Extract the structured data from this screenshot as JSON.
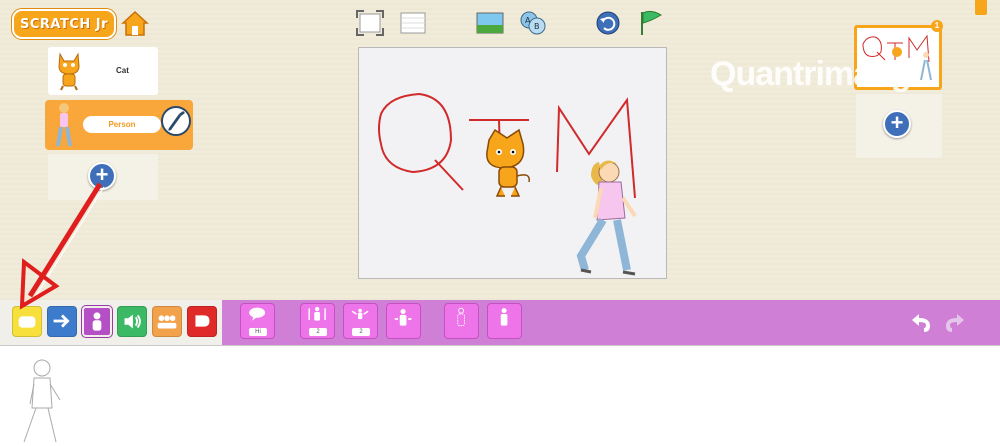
{
  "app": {
    "logo_text": "SCRATCH Jr"
  },
  "sprites": [
    {
      "label": "Cat"
    },
    {
      "label": "Person"
    }
  ],
  "stage": {
    "drawing_letters": [
      "Q",
      "T",
      "M"
    ]
  },
  "pages": {
    "current_page_badge": "1"
  },
  "watermark": "Quantrimang",
  "palette": {
    "categories": [
      {
        "name": "triggering",
        "color": "#f7e03c"
      },
      {
        "name": "motion",
        "color": "#3d7ccc"
      },
      {
        "name": "looks",
        "color": "#b44fc5"
      },
      {
        "name": "sound",
        "color": "#3cb964"
      },
      {
        "name": "control",
        "color": "#f3a24c"
      },
      {
        "name": "end",
        "color": "#e02a2a"
      }
    ],
    "blocks": [
      {
        "icon": "speech-bubble-icon",
        "value": "Hi"
      },
      {
        "icon": "grow-icon",
        "value": "2"
      },
      {
        "icon": "shrink-icon",
        "value": "2"
      },
      {
        "icon": "reset-size-icon",
        "value": ""
      },
      {
        "icon": "hide-icon",
        "value": ""
      },
      {
        "icon": "show-icon",
        "value": ""
      }
    ]
  },
  "colors": {
    "looks_bar": "#cf7fd6",
    "accent": "#f7a51b",
    "annotation_arrow": "#e01e1e"
  }
}
